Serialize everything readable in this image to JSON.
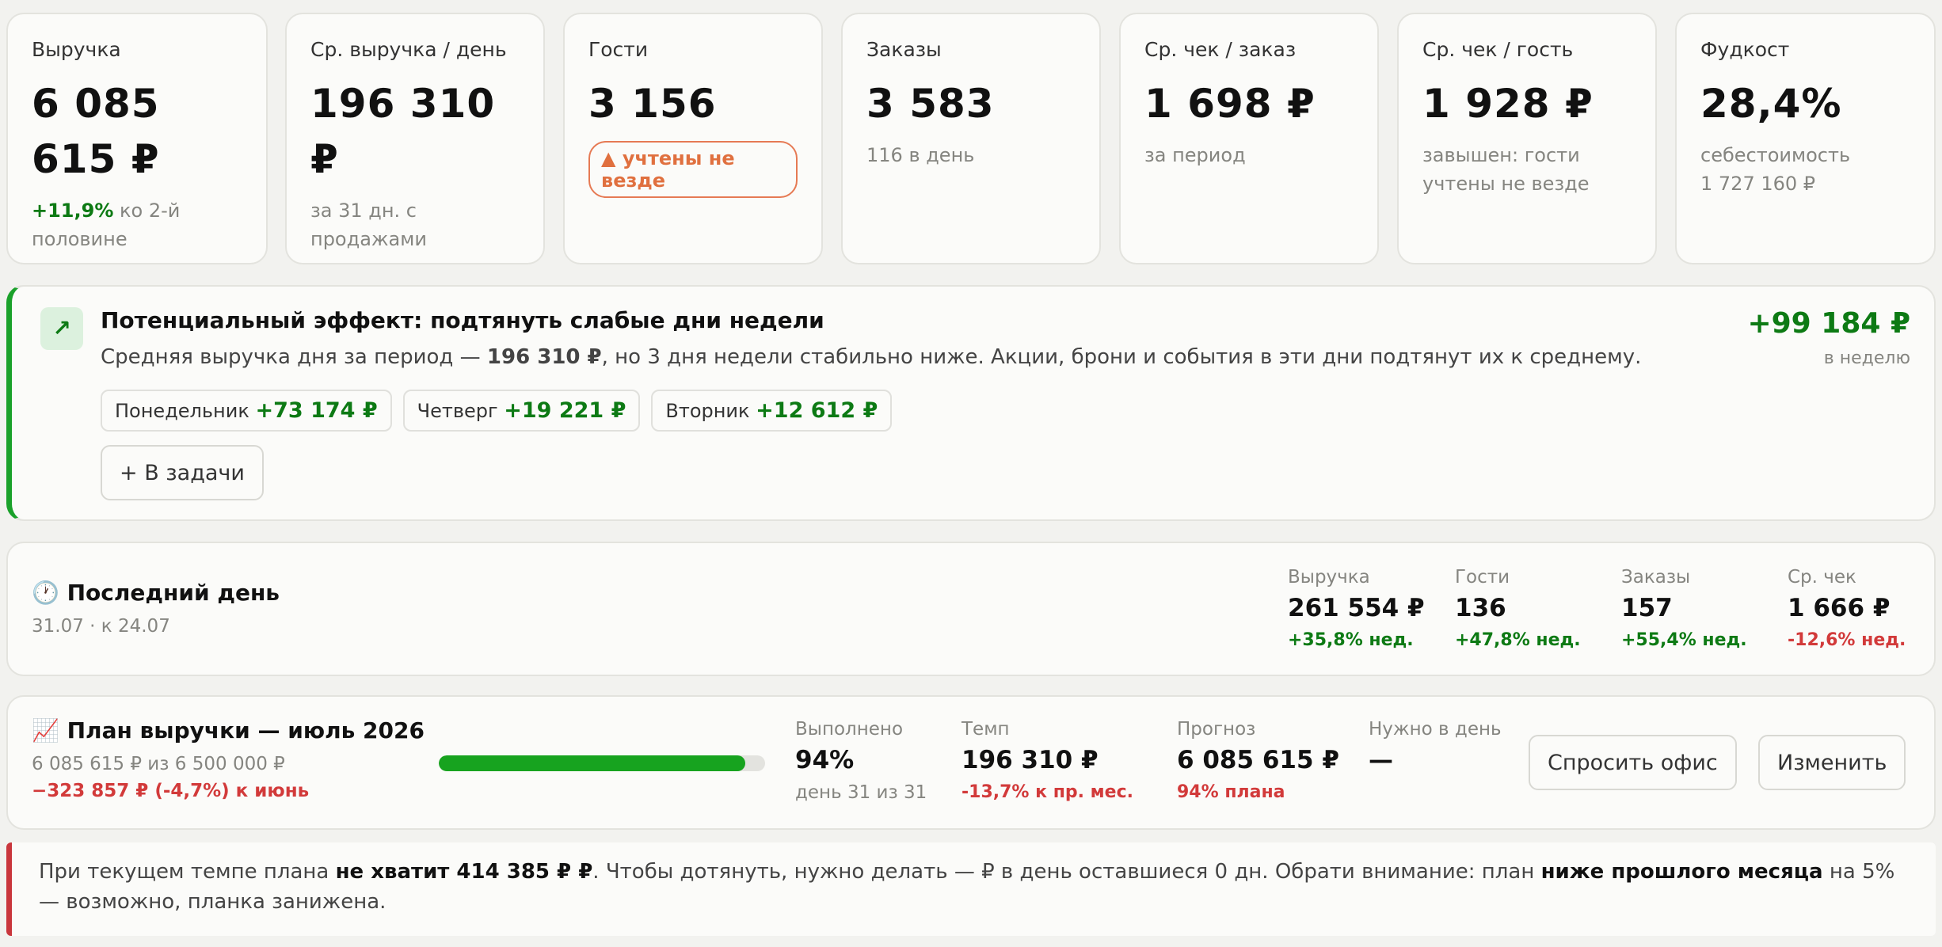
{
  "kpis": [
    {
      "label": "Выручка",
      "value": "6 085 615 ₽",
      "delta": "+11,9%",
      "sub": "ко 2-й половине"
    },
    {
      "label": "Ср. выручка / день",
      "value": "196 310 ₽",
      "sub": "за 31 дн. с продажами"
    },
    {
      "label": "Гости",
      "value": "3 156",
      "badge": "▲ учтены не везде"
    },
    {
      "label": "Заказы",
      "value": "3 583",
      "sub": "116 в день"
    },
    {
      "label": "Ср. чек / заказ",
      "value": "1 698 ₽",
      "sub": "за период"
    },
    {
      "label": "Ср. чек / гость",
      "value": "1 928 ₽",
      "sub": "завышен: гости учтены не везде"
    },
    {
      "label": "Фудкост",
      "value": "28,4%",
      "sub": "себестоимость",
      "sub2": "1 727 160 ₽"
    }
  ],
  "effect": {
    "icon": "trend-up-arrow-icon",
    "title": "Потенциальный эффект: подтянуть слабые дни недели",
    "text_before": "Средняя выручка дня за период — ",
    "text_bold": "196 310 ₽",
    "text_after": ", но 3 дня недели стабильно ниже. Акции, брони и события в эти дни подтянут их к среднему.",
    "amount": "+99 184 ₽",
    "period": "в неделю",
    "days": [
      {
        "name": "Понедельник",
        "value": "+73 174 ₽"
      },
      {
        "name": "Четверг",
        "value": "+19 221 ₽"
      },
      {
        "name": "Вторник",
        "value": "+12 612 ₽"
      }
    ],
    "tasks_button": "+ В задачи"
  },
  "last_day": {
    "icon": "🕐",
    "title": "Последний день",
    "subtitle": "31.07 · к 24.07",
    "metrics": [
      {
        "label": "Выручка",
        "value": "261 554 ₽",
        "delta": "+35,8% нед.",
        "trend": "up"
      },
      {
        "label": "Гости",
        "value": "136",
        "delta": "+47,8% нед.",
        "trend": "up"
      },
      {
        "label": "Заказы",
        "value": "157",
        "delta": "+55,4% нед.",
        "trend": "up"
      },
      {
        "label": "Ср. чек",
        "value": "1 666 ₽",
        "delta": "-12,6% нед.",
        "trend": "down"
      }
    ]
  },
  "plan": {
    "icon": "📈",
    "title": "План выручки — июль 2026",
    "subtitle": "6 085 615 ₽ из 6 500 000 ₽",
    "delta": "−323 857 ₽ (-4,7%) к июнь",
    "progress_fraction": 0.94,
    "done": {
      "label": "Выполнено",
      "value": "94%",
      "sub": "день 31 из 31"
    },
    "pace": {
      "label": "Темп",
      "value": "196 310 ₽",
      "sub": "-13,7% к пр. мес."
    },
    "forecast": {
      "label": "Прогноз",
      "value": "6 085 615 ₽",
      "sub": "94% плана"
    },
    "needed": {
      "label": "Нужно в день",
      "value": "—"
    },
    "ask_button": "Спросить офис",
    "edit_button": "Изменить"
  },
  "note": {
    "t1": "При текущем темпе плана ",
    "b1": "не хватит 414 385 ₽ ₽",
    "t2": ". Чтобы дотянуть, нужно делать — ₽ в день оставшиеся 0 дн. Обрати внимание: план ",
    "b2": "ниже прошлого месяца",
    "t3": " на 5% — возможно, планка занижена."
  },
  "colors": {
    "positive": "#0d7a14",
    "negative": "#d23a3a",
    "warning": "#e0703f",
    "accent_bar": "#17a31f"
  }
}
